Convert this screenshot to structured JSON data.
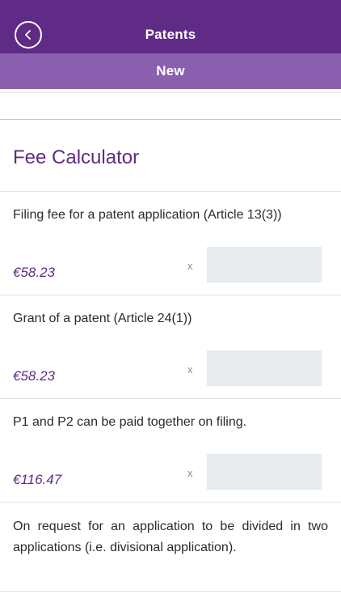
{
  "header": {
    "title": "Patents"
  },
  "subheader": {
    "title": "New"
  },
  "section": {
    "title": "Fee Calculator"
  },
  "fees": [
    {
      "description": "Filing fee for a patent application (Article 13(3))",
      "price": "€58.23",
      "multiplier": "x",
      "quantity": ""
    },
    {
      "description": "Grant of a patent (Article 24(1))",
      "price": "€58.23",
      "multiplier": "x",
      "quantity": ""
    },
    {
      "description": "P1 and P2 can be paid together on filing.",
      "price": "€116.47",
      "multiplier": "x",
      "quantity": ""
    }
  ],
  "info": {
    "text": "On request for an application to be divided in two applications (i.e. divisional application)."
  },
  "colors": {
    "primary": "#5f2b86",
    "secondary": "#8a5fb0",
    "input_bg": "#e8ebee"
  },
  "icons": {
    "back": "chevron-left-icon"
  }
}
